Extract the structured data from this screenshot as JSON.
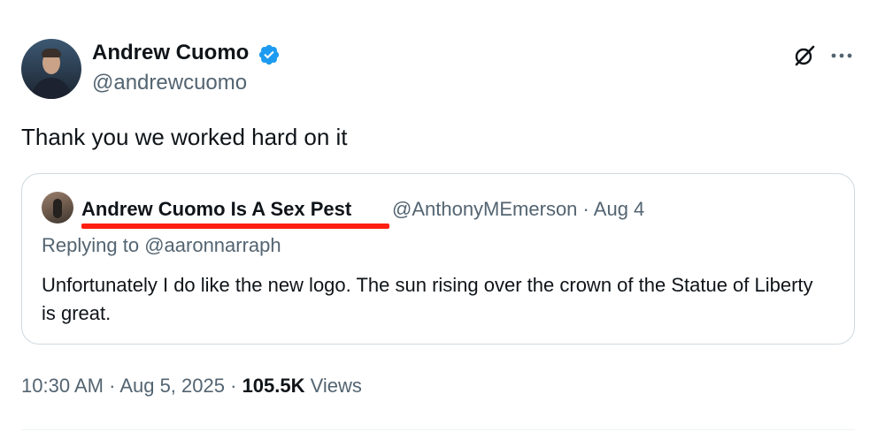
{
  "author": {
    "display_name": "Andrew Cuomo",
    "handle": "@andrewcuomo",
    "verified": true
  },
  "actions": {
    "grok_icon": "grok-icon",
    "more_icon": "more-icon"
  },
  "tweet": {
    "text": "Thank you we worked hard on it"
  },
  "quote": {
    "display_name": "Andrew Cuomo Is A Sex Pest",
    "handle": "@AnthonyMEmerson",
    "separator": "·",
    "date": "Aug 4",
    "replying_to_prefix": "Replying to",
    "replying_to_handle": "@aaronnarraph",
    "text": "Unfortunately I do like the new logo. The sun rising over the crown of the Statue of Liberty is great."
  },
  "footer": {
    "time": "10:30 AM",
    "date": "Aug 5, 2025",
    "separator": "·",
    "views_count": "105.5K",
    "views_label": "Views"
  },
  "colors": {
    "verified_blue": "#1d9bf0",
    "secondary_text": "#536471",
    "primary_text": "#0f1419",
    "highlight_underline": "#ff1f10",
    "border": "#cfd9de"
  }
}
